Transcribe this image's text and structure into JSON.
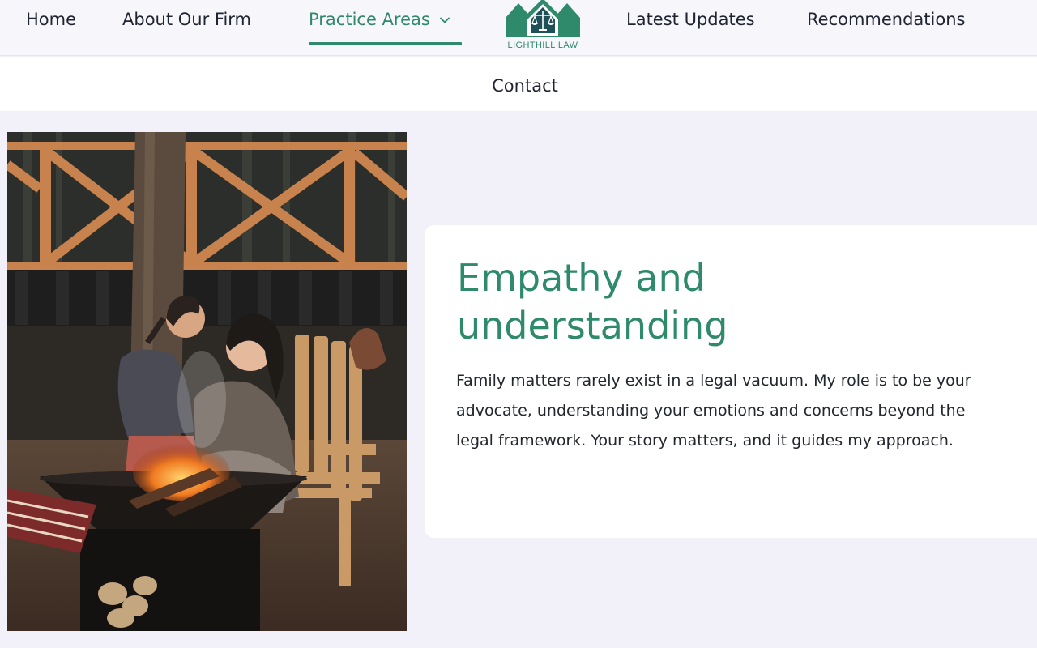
{
  "nav": {
    "items": [
      {
        "label": "Home"
      },
      {
        "label": "About Our Firm"
      },
      {
        "label": "Practice Areas",
        "active": true,
        "has_dropdown": true
      },
      {
        "label": "Latest Updates"
      },
      {
        "label": "Recommendations"
      },
      {
        "label": "Contact"
      }
    ],
    "logo_text": "LIGHTHILL LAW"
  },
  "section": {
    "title": "Empathy and understanding",
    "body": "Family matters rarely exist in a legal vacuum. My role is to be your advocate, understanding your emotions and concerns beyond the legal framework. Your story matters, and it guides my approach."
  },
  "icons": {
    "dropdown": "chevron-down-icon",
    "logo": "house-scales-logo",
    "photo": "family-fire-pit-photo"
  },
  "colors": {
    "brand": "#2e8a6b",
    "text": "#1f2430",
    "page_bg": "#f2f1f9",
    "card_bg": "#ffffff"
  }
}
